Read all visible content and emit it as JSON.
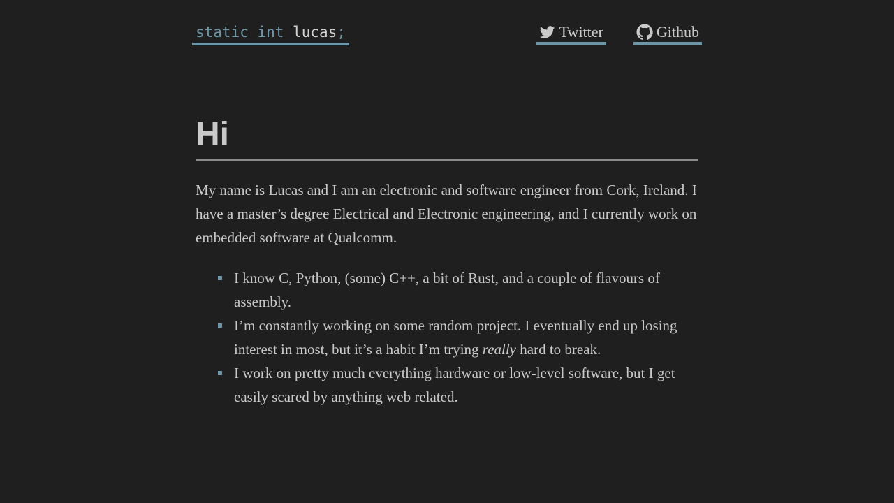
{
  "header": {
    "logo": {
      "keyword1": "static",
      "keyword2": "int",
      "identifier": "lucas",
      "terminator": ";"
    },
    "nav": [
      {
        "label": "Twitter",
        "icon": "twitter-icon"
      },
      {
        "label": "Github",
        "icon": "github-icon"
      }
    ]
  },
  "main": {
    "heading": "Hi",
    "intro": "My name is Lucas and I am an electronic and software engineer from Cork, Ireland. I have a master’s degree Electrical and Electronic engineering, and I currently work on embedded software at Qualcomm.",
    "facts": [
      {
        "text": "I know C, Python, (some) C++, a bit of Rust, and a couple of flavours of assembly."
      },
      {
        "before": "I’m constantly working on some random project. I eventually end up losing interest in most, but it’s a habit I’m trying ",
        "emphasis": "really",
        "after": " hard to break."
      },
      {
        "text": "I work on pretty much everything hardware or low-level software, but I get easily scared by anything web related."
      }
    ]
  },
  "colors": {
    "background": "#1f1f1f",
    "text": "#c9c9c9",
    "accent": "#6d97a6"
  }
}
